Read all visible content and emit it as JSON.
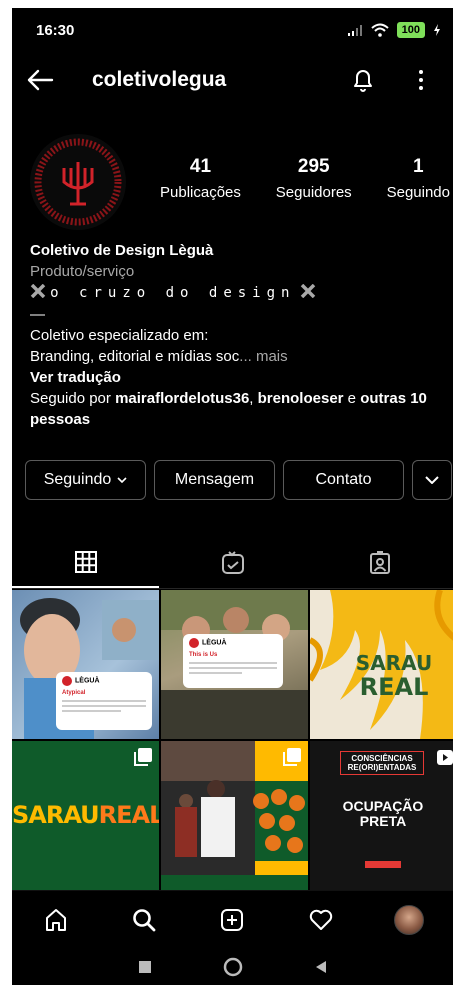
{
  "status_bar": {
    "time": "16:30",
    "battery": "100"
  },
  "header": {
    "username": "coletivolegua"
  },
  "profile": {
    "stats": [
      {
        "value": "41",
        "label": "Publicações"
      },
      {
        "value": "295",
        "label": "Seguidores"
      },
      {
        "value": "1",
        "label": "Seguindo"
      }
    ]
  },
  "bio": {
    "name": "Coletivo de Design Lèguà",
    "category": "Produto/serviço",
    "tagline": "o cruzo do design",
    "dash": "—",
    "line1": "Coletivo especializado em:",
    "line2": "Branding, editorial e mídias soc",
    "more": "... mais",
    "translate": "Ver tradução",
    "followed_prefix": "Seguido por ",
    "followed_user1": "mairaflordelotus36",
    "followed_sep": ", ",
    "followed_user2": "brenoloeser",
    "followed_and": " e ",
    "followed_others": "outras 10 pessoas"
  },
  "actions": {
    "following": "Seguindo",
    "message": "Mensagem",
    "contact": "Contato"
  },
  "grid": {
    "tile1_tweet_name": "LÈGUÀ",
    "tile1_tweet_text": "Atypical",
    "tile2_tweet_name": "LÈGUÀ",
    "tile2_tweet_text": "This is Us",
    "tile3_text_top": "SARAU",
    "tile3_text_bottom": "REAL",
    "tile4_text_a": "SARAU",
    "tile4_text_b": "REAL",
    "tile6_box": "CONSCIÊNCIAS RE(ORI)ENTADAS",
    "tile6_title": "OCUPAÇÃO PRETA"
  },
  "colors": {
    "background": "#000000",
    "accent_red": "#d2232a",
    "sarau_green": "#0f5b2a",
    "sarau_orange": "#ffba00"
  }
}
